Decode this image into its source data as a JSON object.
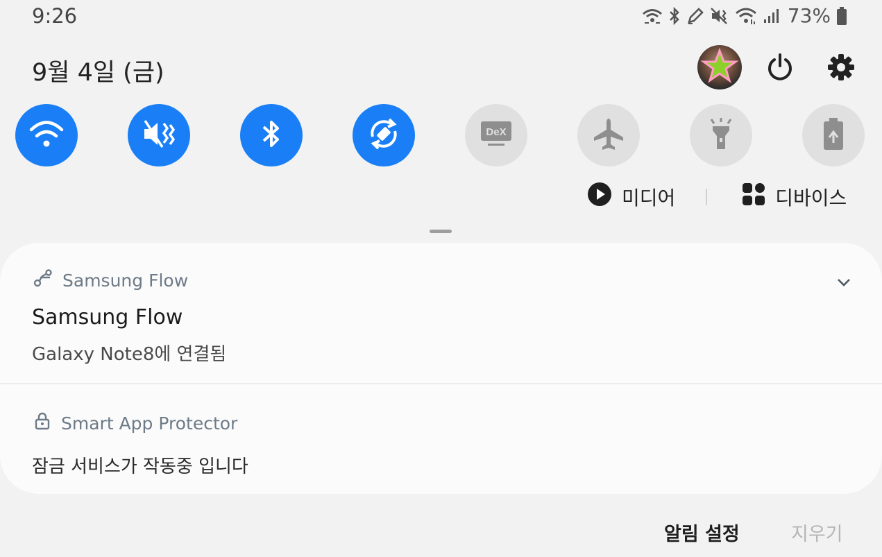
{
  "status_bar": {
    "time": "9:26",
    "battery": "73%",
    "icons": [
      "wifi-calling-icon",
      "bluetooth-icon",
      "pen-icon",
      "mute-vibrate-icon",
      "wifi-icon",
      "signal-icon",
      "battery-icon"
    ]
  },
  "header": {
    "date": "9월 4일 (금)"
  },
  "quick_toggles": [
    {
      "name": "wifi",
      "icon": "wifi-icon",
      "state": "on"
    },
    {
      "name": "sound",
      "icon": "mute-vibrate-icon",
      "state": "on"
    },
    {
      "name": "bluetooth",
      "icon": "bluetooth-icon",
      "state": "on"
    },
    {
      "name": "auto-rotate",
      "icon": "rotate-icon",
      "state": "on"
    },
    {
      "name": "dex",
      "icon": "dex-icon",
      "state": "off",
      "icon_text": "DeX"
    },
    {
      "name": "airplane",
      "icon": "airplane-icon",
      "state": "off"
    },
    {
      "name": "flashlight",
      "icon": "flashlight-icon",
      "state": "off"
    },
    {
      "name": "power-saving",
      "icon": "battery-saver-icon",
      "state": "off"
    }
  ],
  "media_row": {
    "media_label": "미디어",
    "devices_label": "디바이스"
  },
  "notifications": [
    {
      "app_name": "Samsung Flow",
      "app_icon": "samsung-flow-icon",
      "title": "Samsung Flow",
      "text": "Galaxy Note8에 연결됨"
    },
    {
      "app_name": "Smart App Protector",
      "app_icon": "lock-icon",
      "text": "잠금 서비스가 작동중 입니다"
    }
  ],
  "footer": {
    "settings_label": "알림 설정",
    "clear_label": "지우기"
  },
  "colors": {
    "toggle_on": "#1a7ff6",
    "toggle_off": "#e0e0e0",
    "background": "#f2f2f2",
    "panel": "#fbfbfb"
  }
}
